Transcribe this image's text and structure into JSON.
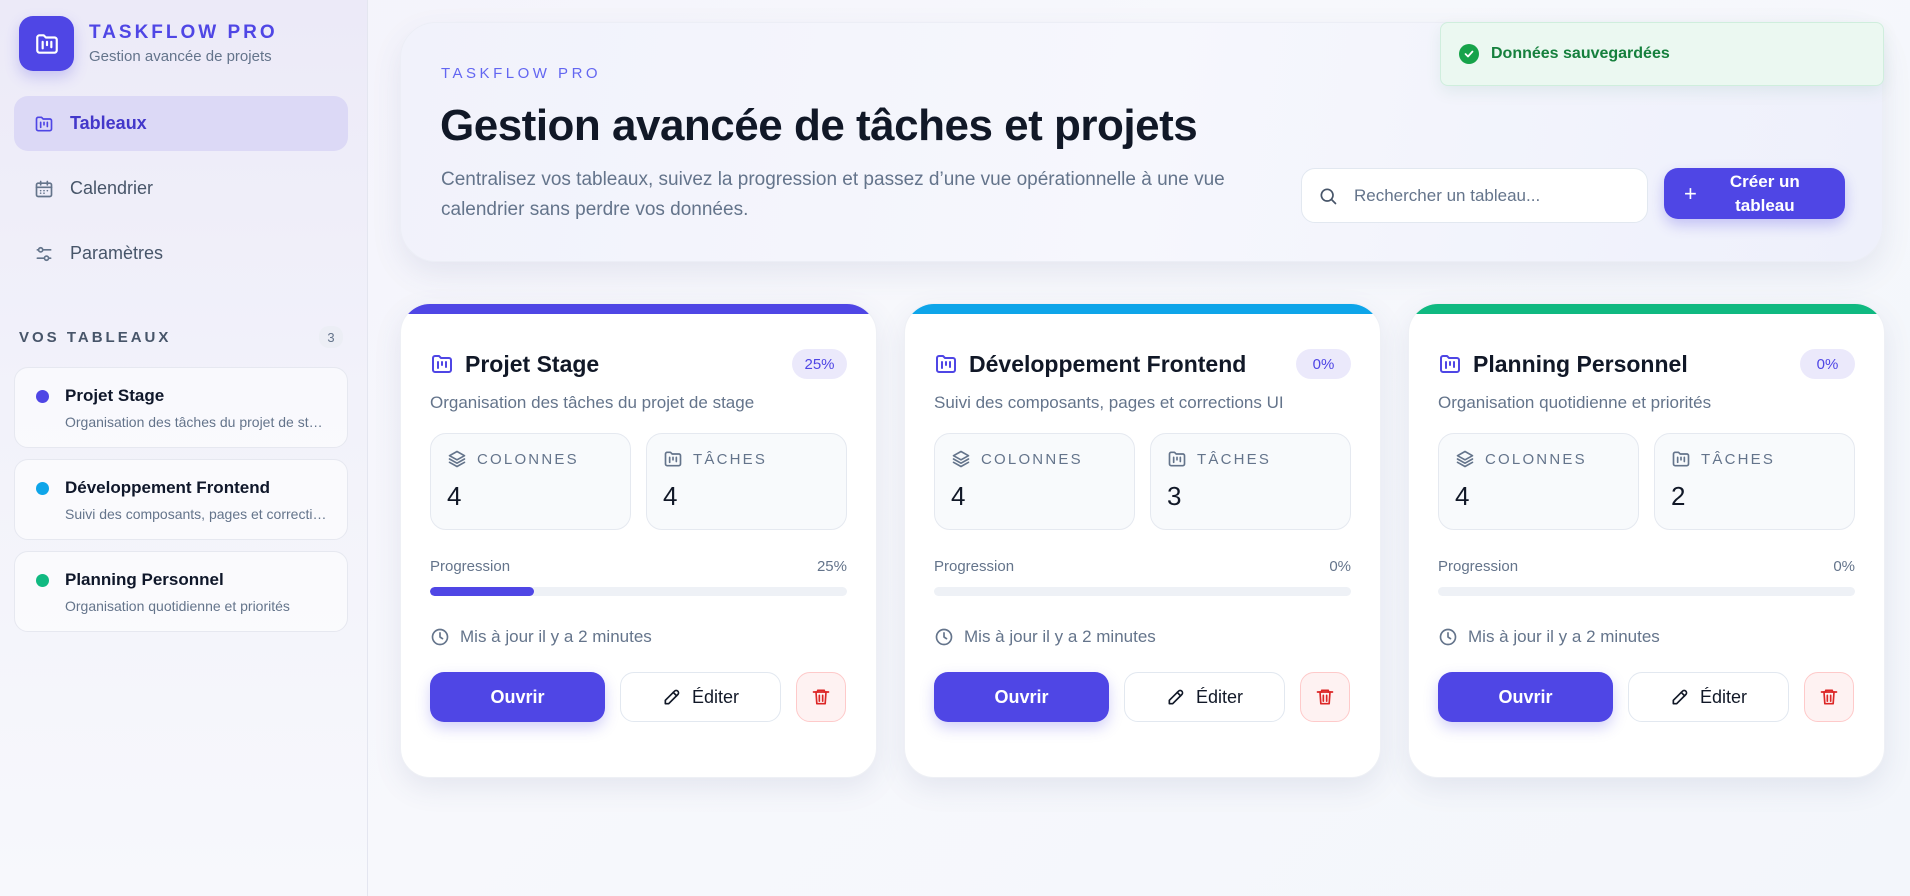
{
  "brand": {
    "name": "TASKFLOW PRO",
    "subtitle": "Gestion avancée de projets"
  },
  "nav": [
    {
      "label": "Tableaux",
      "icon": "board-icon",
      "active": true
    },
    {
      "label": "Calendrier",
      "icon": "calendar-icon",
      "active": false
    },
    {
      "label": "Paramètres",
      "icon": "sliders-icon",
      "active": false
    }
  ],
  "sidebar_boards": {
    "title": "VOS TABLEAUX",
    "count": "3",
    "items": [
      {
        "name": "Projet Stage",
        "desc": "Organisation des tâches du projet de stage",
        "color": "#4f46e5"
      },
      {
        "name": "Développement Frontend",
        "desc": "Suivi des composants, pages et corrections UI",
        "color": "#0ea5e9"
      },
      {
        "name": "Planning Personnel",
        "desc": "Organisation quotidienne et priorités",
        "color": "#10b981"
      }
    ]
  },
  "hero": {
    "eyebrow": "TASKFLOW PRO",
    "title": "Gestion avancée de tâches et projets",
    "desc": "Centralisez vos tableaux, suivez la progression et passez d’une vue opérationnelle à une vue calendrier sans perdre vos données.",
    "search_placeholder": "Rechercher un tableau...",
    "create_label": "Créer un tableau"
  },
  "toast": {
    "text": "Données sauvegardées"
  },
  "labels": {
    "columns": "COLONNES",
    "tasks": "TÂCHES",
    "progress": "Progression",
    "open": "Ouvrir",
    "edit": "Éditer"
  },
  "cards": [
    {
      "title": "Projet Stage",
      "desc": "Organisation des tâches du projet de stage",
      "badge": "25%",
      "columns": "4",
      "tasks": "4",
      "progress_text": "25%",
      "progress": 25,
      "updated": "Mis à jour il y a 2 minutes",
      "color": "#4f46e5"
    },
    {
      "title": "Développement Frontend",
      "desc": "Suivi des composants, pages et corrections UI",
      "badge": "0%",
      "columns": "4",
      "tasks": "3",
      "progress_text": "0%",
      "progress": 0,
      "updated": "Mis à jour il y a 2 minutes",
      "color": "#0ea5e9"
    },
    {
      "title": "Planning Personnel",
      "desc": "Organisation quotidienne et priorités",
      "badge": "0%",
      "columns": "4",
      "tasks": "2",
      "progress_text": "0%",
      "progress": 0,
      "updated": "Mis à jour il y a 2 minutes",
      "color": "#10b981"
    }
  ],
  "colors": {
    "accent": "#4f46e5",
    "success": "#16a34a",
    "danger": "#dc2626"
  }
}
